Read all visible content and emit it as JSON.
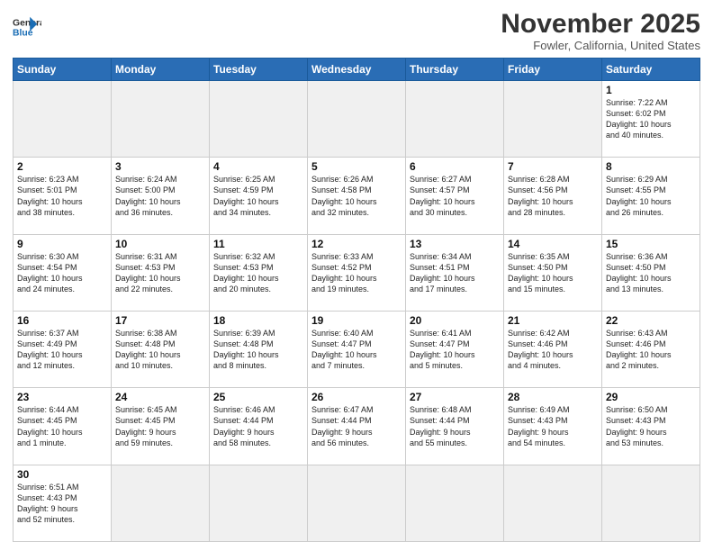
{
  "header": {
    "logo_general": "General",
    "logo_blue": "Blue",
    "month_title": "November 2025",
    "location": "Fowler, California, United States"
  },
  "days_of_week": [
    "Sunday",
    "Monday",
    "Tuesday",
    "Wednesday",
    "Thursday",
    "Friday",
    "Saturday"
  ],
  "weeks": [
    [
      {
        "day": "",
        "info": "",
        "empty": true
      },
      {
        "day": "",
        "info": "",
        "empty": true
      },
      {
        "day": "",
        "info": "",
        "empty": true
      },
      {
        "day": "",
        "info": "",
        "empty": true
      },
      {
        "day": "",
        "info": "",
        "empty": true
      },
      {
        "day": "",
        "info": "",
        "empty": true
      },
      {
        "day": "1",
        "info": "Sunrise: 7:22 AM\nSunset: 6:02 PM\nDaylight: 10 hours\nand 40 minutes."
      }
    ],
    [
      {
        "day": "2",
        "info": "Sunrise: 6:23 AM\nSunset: 5:01 PM\nDaylight: 10 hours\nand 38 minutes."
      },
      {
        "day": "3",
        "info": "Sunrise: 6:24 AM\nSunset: 5:00 PM\nDaylight: 10 hours\nand 36 minutes."
      },
      {
        "day": "4",
        "info": "Sunrise: 6:25 AM\nSunset: 4:59 PM\nDaylight: 10 hours\nand 34 minutes."
      },
      {
        "day": "5",
        "info": "Sunrise: 6:26 AM\nSunset: 4:58 PM\nDaylight: 10 hours\nand 32 minutes."
      },
      {
        "day": "6",
        "info": "Sunrise: 6:27 AM\nSunset: 4:57 PM\nDaylight: 10 hours\nand 30 minutes."
      },
      {
        "day": "7",
        "info": "Sunrise: 6:28 AM\nSunset: 4:56 PM\nDaylight: 10 hours\nand 28 minutes."
      },
      {
        "day": "8",
        "info": "Sunrise: 6:29 AM\nSunset: 4:55 PM\nDaylight: 10 hours\nand 26 minutes."
      }
    ],
    [
      {
        "day": "9",
        "info": "Sunrise: 6:30 AM\nSunset: 4:54 PM\nDaylight: 10 hours\nand 24 minutes."
      },
      {
        "day": "10",
        "info": "Sunrise: 6:31 AM\nSunset: 4:53 PM\nDaylight: 10 hours\nand 22 minutes."
      },
      {
        "day": "11",
        "info": "Sunrise: 6:32 AM\nSunset: 4:53 PM\nDaylight: 10 hours\nand 20 minutes."
      },
      {
        "day": "12",
        "info": "Sunrise: 6:33 AM\nSunset: 4:52 PM\nDaylight: 10 hours\nand 19 minutes."
      },
      {
        "day": "13",
        "info": "Sunrise: 6:34 AM\nSunset: 4:51 PM\nDaylight: 10 hours\nand 17 minutes."
      },
      {
        "day": "14",
        "info": "Sunrise: 6:35 AM\nSunset: 4:50 PM\nDaylight: 10 hours\nand 15 minutes."
      },
      {
        "day": "15",
        "info": "Sunrise: 6:36 AM\nSunset: 4:50 PM\nDaylight: 10 hours\nand 13 minutes."
      }
    ],
    [
      {
        "day": "16",
        "info": "Sunrise: 6:37 AM\nSunset: 4:49 PM\nDaylight: 10 hours\nand 12 minutes."
      },
      {
        "day": "17",
        "info": "Sunrise: 6:38 AM\nSunset: 4:48 PM\nDaylight: 10 hours\nand 10 minutes."
      },
      {
        "day": "18",
        "info": "Sunrise: 6:39 AM\nSunset: 4:48 PM\nDaylight: 10 hours\nand 8 minutes."
      },
      {
        "day": "19",
        "info": "Sunrise: 6:40 AM\nSunset: 4:47 PM\nDaylight: 10 hours\nand 7 minutes."
      },
      {
        "day": "20",
        "info": "Sunrise: 6:41 AM\nSunset: 4:47 PM\nDaylight: 10 hours\nand 5 minutes."
      },
      {
        "day": "21",
        "info": "Sunrise: 6:42 AM\nSunset: 4:46 PM\nDaylight: 10 hours\nand 4 minutes."
      },
      {
        "day": "22",
        "info": "Sunrise: 6:43 AM\nSunset: 4:46 PM\nDaylight: 10 hours\nand 2 minutes."
      }
    ],
    [
      {
        "day": "23",
        "info": "Sunrise: 6:44 AM\nSunset: 4:45 PM\nDaylight: 10 hours\nand 1 minute."
      },
      {
        "day": "24",
        "info": "Sunrise: 6:45 AM\nSunset: 4:45 PM\nDaylight: 9 hours\nand 59 minutes."
      },
      {
        "day": "25",
        "info": "Sunrise: 6:46 AM\nSunset: 4:44 PM\nDaylight: 9 hours\nand 58 minutes."
      },
      {
        "day": "26",
        "info": "Sunrise: 6:47 AM\nSunset: 4:44 PM\nDaylight: 9 hours\nand 56 minutes."
      },
      {
        "day": "27",
        "info": "Sunrise: 6:48 AM\nSunset: 4:44 PM\nDaylight: 9 hours\nand 55 minutes."
      },
      {
        "day": "28",
        "info": "Sunrise: 6:49 AM\nSunset: 4:43 PM\nDaylight: 9 hours\nand 54 minutes."
      },
      {
        "day": "29",
        "info": "Sunrise: 6:50 AM\nSunset: 4:43 PM\nDaylight: 9 hours\nand 53 minutes."
      }
    ],
    [
      {
        "day": "30",
        "info": "Sunrise: 6:51 AM\nSunset: 4:43 PM\nDaylight: 9 hours\nand 52 minutes."
      },
      {
        "day": "",
        "info": "",
        "empty": true
      },
      {
        "day": "",
        "info": "",
        "empty": true
      },
      {
        "day": "",
        "info": "",
        "empty": true
      },
      {
        "day": "",
        "info": "",
        "empty": true
      },
      {
        "day": "",
        "info": "",
        "empty": true
      },
      {
        "day": "",
        "info": "",
        "empty": true
      }
    ]
  ]
}
